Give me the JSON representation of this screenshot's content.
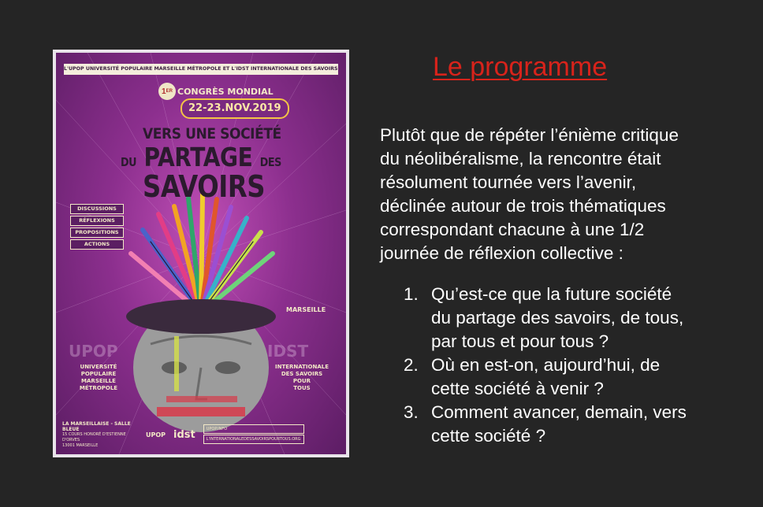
{
  "slide": {
    "heading": "Le programme",
    "intro_lines": [
      "Plutôt que de répéter l’énième critique",
      "du néolibéralisme, la rencontre était",
      "résolument tournée vers l’avenir,",
      "déclinée autour de trois thématiques",
      "correspondant chacune à une 1/2",
      "journée de réflexion collective :"
    ],
    "questions": [
      {
        "number": "1.",
        "lines": [
          "Qu’est-ce que la future société",
          "du partage des savoirs, de tous,",
          "par tous et pour tous ?"
        ]
      },
      {
        "number": "2.",
        "lines": [
          "Où en est-on, aujourd’hui, de",
          "cette société à venir ?"
        ]
      },
      {
        "number": "3.",
        "lines": [
          "Comment avancer, demain, vers",
          "cette société ?"
        ]
      }
    ]
  },
  "poster": {
    "top_banner": "L'UPOP UNIVERSITÉ POPULAIRE MARSEILLE MÉTROPOLE ET L'IDST INTERNATIONALE DES SAVOIRS POUR TOUS",
    "ordinal": "1",
    "ordinal_suffix": "ER",
    "congres": "CONGRÈS MONDIAL",
    "dates": "22-23.NOV.2019",
    "title_line1": "VERS UNE SOCIÉTÉ",
    "title_line2_du": "DU",
    "title_line2": "PARTAGE",
    "title_line2_des": "DES",
    "title_line3": "SAVOIRS",
    "tags": [
      "DISCUSSIONS",
      "RÉFLEXIONS",
      "PROPOSITIONS",
      "ACTIONS"
    ],
    "city": "MARSEILLE",
    "ghost_left": "UPOP",
    "ghost_right": "IDST",
    "org_left": [
      "UNIVERSITÉ",
      "POPULAIRE",
      "MARSEILLE",
      "MÉTROPOLE"
    ],
    "org_right": [
      "INTERNATIONALE",
      "DES SAVOIRS",
      "POUR",
      "TOUS"
    ],
    "venue_head": "LA MARSEILLAISE - SALLE BLEUE",
    "venue_lines": [
      "15 COURS HONORÉ D'ESTIENNE D'ORVES",
      "13001 MARSEILLE"
    ],
    "logo_upop": "UPOP",
    "logo_idst": "idst",
    "link_1": "UPOP.INFO",
    "link_2": "L'INTERNATIONALEDESSAVOIRSPOURTOUS.ORG"
  },
  "colors": {
    "background": "#252525",
    "heading": "#d8231b",
    "body_text": "#ffffff",
    "poster_purple": "#8c2f8e"
  }
}
